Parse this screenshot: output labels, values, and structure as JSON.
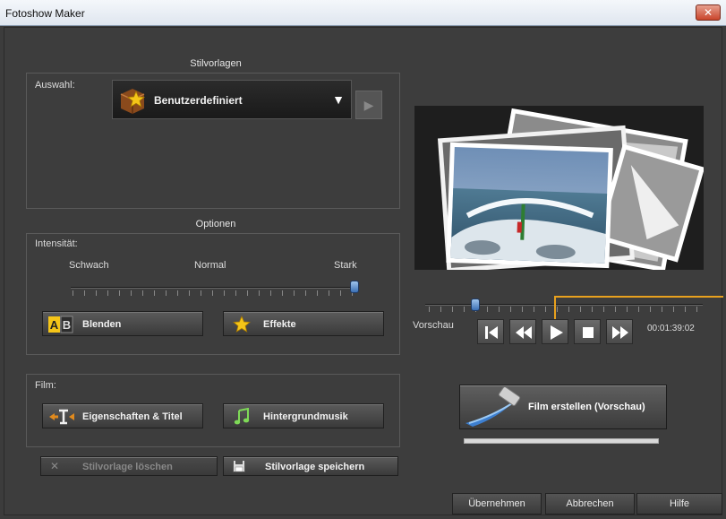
{
  "window": {
    "title": "Fotoshow Maker",
    "close_glyph": "✕"
  },
  "stil": {
    "header": "Stilvorlagen",
    "auswahl_label": "Auswahl:",
    "selected": "Benutzerdefiniert",
    "icon": "star-box-icon"
  },
  "optionen": {
    "header": "Optionen",
    "intensitaet_label": "Intensität:",
    "scale_left": "Schwach",
    "scale_mid": "Normal",
    "scale_right": "Stark",
    "intensity_fraction": 1.0,
    "blenden_label": "Blenden",
    "effekte_label": "Effekte"
  },
  "film": {
    "label": "Film:",
    "eigenschaften_label": "Eigenschaften & Titel",
    "musik_label": "Hintergrundmusik"
  },
  "stil_actions": {
    "loeschen_label": "Stilvorlage löschen",
    "speichern_label": "Stilvorlage speichern"
  },
  "player": {
    "vorschau_label": "Vorschau",
    "timecode": "00:01:39:02",
    "position_fraction": 0.18,
    "film_button_label": "Film erstellen (Vorschau)"
  },
  "footer": {
    "uebernehmen": "Übernehmen",
    "abbrechen": "Abbrechen",
    "hilfe": "Hilfe"
  },
  "colors": {
    "accent": "#e8a11e",
    "thumb": "#3b6fb4"
  }
}
